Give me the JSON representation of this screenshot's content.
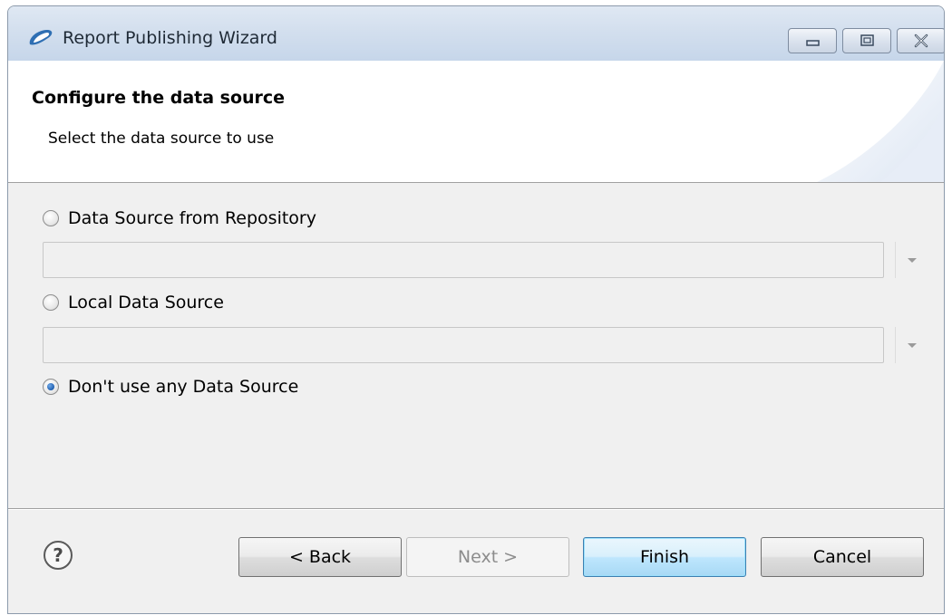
{
  "window": {
    "title": "Report Publishing Wizard",
    "controls": [
      "minimize",
      "maximize",
      "close"
    ]
  },
  "header": {
    "title": "Configure the data source",
    "description": "Select the data source to use"
  },
  "options": [
    {
      "label": "Data Source from Repository",
      "selected": false,
      "combo_value": ""
    },
    {
      "label": "Local Data Source",
      "selected": false,
      "combo_value": ""
    },
    {
      "label": "Don't use any Data Source",
      "selected": true
    }
  ],
  "buttons": {
    "back": "< Back",
    "next": "Next >",
    "finish": "Finish",
    "cancel": "Cancel"
  },
  "states": {
    "next_enabled": false,
    "finish_default": true
  },
  "icons": {
    "app": "jaspersoft-swoosh-icon",
    "help": "question-mark-icon"
  },
  "colors": {
    "titlebar": "#d3dfee",
    "window_bg": "#f0f0f0",
    "default_button_border": "#3c7fb1"
  }
}
